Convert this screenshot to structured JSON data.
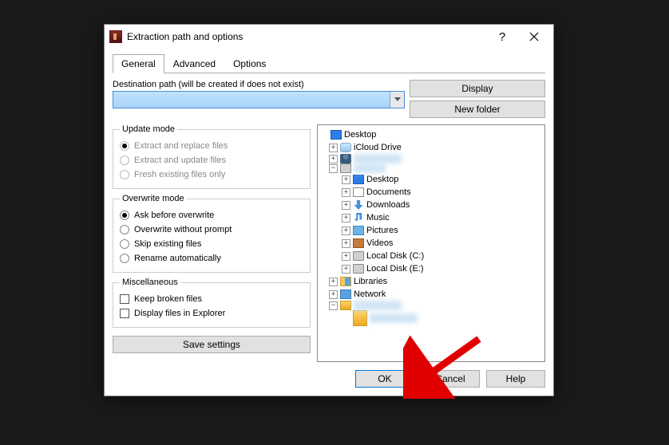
{
  "titlebar": {
    "title": "Extraction path and options"
  },
  "tabs": {
    "general": "General",
    "advanced": "Advanced",
    "options": "Options"
  },
  "dest": {
    "label": "Destination path (will be created if does not exist)",
    "value": ""
  },
  "buttons": {
    "display": "Display",
    "newfolder": "New folder",
    "save": "Save settings",
    "ok": "OK",
    "cancel": "Cancel",
    "help": "Help"
  },
  "groups": {
    "update": {
      "legend": "Update mode",
      "opt1": "Extract and replace files",
      "opt2": "Extract and update files",
      "opt3": "Fresh existing files only"
    },
    "overwrite": {
      "legend": "Overwrite mode",
      "opt1": "Ask before overwrite",
      "opt2": "Overwrite without prompt",
      "opt3": "Skip existing files",
      "opt4": "Rename automatically"
    },
    "misc": {
      "legend": "Miscellaneous",
      "opt1": "Keep broken files",
      "opt2": "Display files in Explorer"
    }
  },
  "tree": {
    "desktop": "Desktop",
    "icloud": "iCloud Drive",
    "thispc_desktop": "Desktop",
    "documents": "Documents",
    "downloads": "Downloads",
    "music": "Music",
    "pictures": "Pictures",
    "videos": "Videos",
    "diskc": "Local Disk (C:)",
    "diske": "Local Disk (E:)",
    "libraries": "Libraries",
    "network": "Network"
  }
}
